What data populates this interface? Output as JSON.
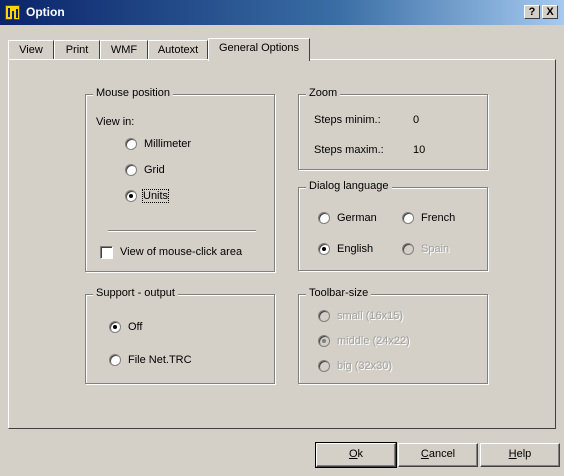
{
  "window": {
    "title": "Option",
    "help_btn": "?",
    "close_btn": "X"
  },
  "tabs": [
    {
      "label": "View"
    },
    {
      "label": "Print"
    },
    {
      "label": "WMF"
    },
    {
      "label": "Autotext"
    },
    {
      "label": "General Options",
      "active": true
    }
  ],
  "mouse_position": {
    "title": "Mouse position",
    "view_in_label": "View in:",
    "options": [
      {
        "label": "Millimeter",
        "checked": false
      },
      {
        "label": "Grid",
        "checked": false
      },
      {
        "label": "Units",
        "checked": true
      }
    ],
    "checkbox_label": "View of mouse-click area",
    "checkbox_checked": false
  },
  "zoom": {
    "title": "Zoom",
    "steps_min_label": "Steps minim.:",
    "steps_min_value": "0",
    "steps_max_label": "Steps maxim.:",
    "steps_max_value": "10"
  },
  "dialog_language": {
    "title": "Dialog language",
    "options": [
      {
        "label": "German",
        "checked": false,
        "enabled": true
      },
      {
        "label": "French",
        "checked": false,
        "enabled": true
      },
      {
        "label": "English",
        "checked": true,
        "enabled": true
      },
      {
        "label": "Spain",
        "checked": false,
        "enabled": false
      }
    ]
  },
  "support_output": {
    "title": "Support - output",
    "options": [
      {
        "label": "Off",
        "checked": true
      },
      {
        "label": "File Net.TRC",
        "checked": false
      }
    ]
  },
  "toolbar_size": {
    "title": "Toolbar-size",
    "options": [
      {
        "label": "small (16x15)",
        "checked": false,
        "enabled": false
      },
      {
        "label": "middle (24x22)",
        "checked": true,
        "enabled": false
      },
      {
        "label": "big (32x30)",
        "checked": false,
        "enabled": false
      }
    ]
  },
  "buttons": {
    "ok": {
      "accel": "O",
      "rest": "k"
    },
    "cancel": {
      "accel": "C",
      "rest": "ancel"
    },
    "help": {
      "accel": "H",
      "rest": "elp"
    }
  }
}
